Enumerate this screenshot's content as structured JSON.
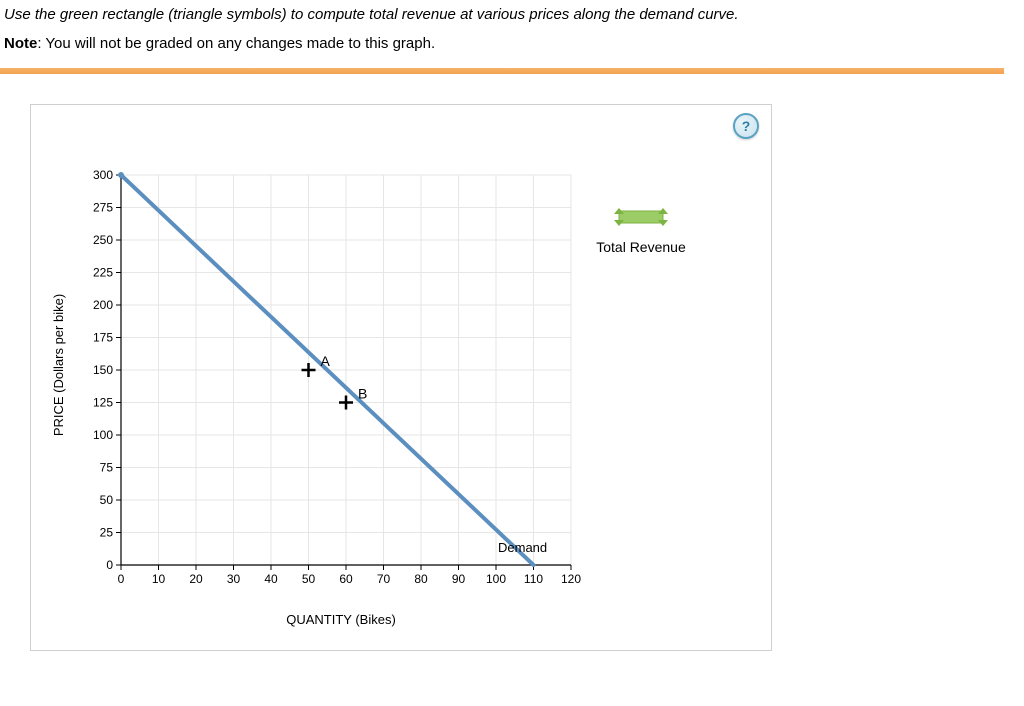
{
  "instruction": "Use the green rectangle (triangle symbols) to compute total revenue at various prices along the demand curve.",
  "note_prefix": "Note",
  "note_text": ": You will not be graded on any changes made to this graph.",
  "help_symbol": "?",
  "legend": {
    "label": "Total Revenue"
  },
  "axes": {
    "y_label": "PRICE (Dollars per bike)",
    "x_label": "QUANTITY (Bikes)",
    "y_ticks": [
      "0",
      "25",
      "50",
      "75",
      "100",
      "125",
      "150",
      "175",
      "200",
      "225",
      "250",
      "275",
      "300"
    ],
    "x_ticks": [
      "0",
      "10",
      "20",
      "30",
      "40",
      "50",
      "60",
      "70",
      "80",
      "90",
      "100",
      "110",
      "120"
    ]
  },
  "points": {
    "A": {
      "label": "A",
      "x": 50,
      "y": 150
    },
    "B": {
      "label": "B",
      "x": 60,
      "y": 125
    }
  },
  "demand_label": "Demand",
  "chart_data": {
    "type": "line",
    "title": "",
    "xlabel": "QUANTITY (Bikes)",
    "ylabel": "PRICE (Dollars per bike)",
    "xlim": [
      0,
      120
    ],
    "ylim": [
      0,
      300
    ],
    "series": [
      {
        "name": "Demand",
        "x": [
          0,
          110
        ],
        "y": [
          300,
          0
        ]
      }
    ],
    "annotations": [
      {
        "name": "A",
        "x": 50,
        "y": 150,
        "symbol": "plus"
      },
      {
        "name": "B",
        "x": 60,
        "y": 125,
        "symbol": "plus"
      }
    ],
    "legend_items": [
      {
        "name": "Total Revenue",
        "color": "#8bc34a",
        "shape": "rectangle-with-triangle-handles"
      }
    ]
  }
}
